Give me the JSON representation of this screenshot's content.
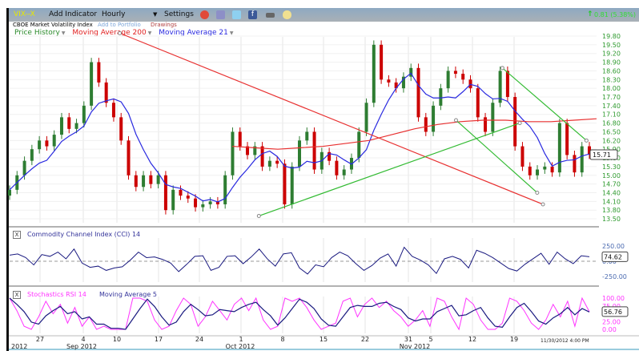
{
  "toolbar": {
    "symbol": "VIX--X",
    "add_indicator": "Add Indicator",
    "interval": "Hourly",
    "settings": "Settings",
    "change": "0.81 (5.38%)",
    "icons": [
      "alarm-clock-icon",
      "portfolio-icon",
      "twitter-icon",
      "facebook-icon",
      "camera-icon",
      "note-icon"
    ]
  },
  "subheader": {
    "name": "CBOE Market Volatility Index",
    "add_to_portfolio": "Add to Portfolio",
    "drawings": "Drawings"
  },
  "legend": {
    "price_history": "Price History",
    "ma200": "Moving Average 200",
    "ma21": "Moving Average 21"
  },
  "colors": {
    "up": "#2e7d32",
    "down": "#cc0000",
    "ma200": "#e83030",
    "ma21": "#2a2ae0",
    "trend": "#33bb33",
    "cci": "#1a1a80",
    "stoch": "#ff33ff",
    "axis_text": "#2e9a2e"
  },
  "chart_data": [
    {
      "type": "candlestick",
      "title": "",
      "ylim": [
        13.5,
        19.8
      ],
      "y_ticks": [
        "19.80",
        "19.50",
        "19.20",
        "18.90",
        "18.60",
        "18.30",
        "18.00",
        "17.70",
        "17.40",
        "17.10",
        "16.80",
        "16.50",
        "16.20",
        "15.90",
        "15.60",
        "15.30",
        "15.00",
        "14.70",
        "14.40",
        "14.10",
        "13.80",
        "13.50"
      ],
      "last_value": "15.71",
      "close": [
        14.5,
        15.0,
        15.5,
        15.9,
        16.2,
        16.0,
        16.4,
        17.0,
        16.6,
        16.8,
        17.4,
        18.9,
        18.2,
        17.5,
        17.0,
        16.2,
        15.0,
        14.6,
        15.0,
        14.7,
        15.0,
        13.8,
        14.5,
        14.3,
        14.2,
        13.9,
        14.0,
        14.1,
        14.0,
        15.0,
        16.5,
        16.0,
        15.7,
        16.0,
        15.3,
        15.5,
        15.4,
        14.0,
        15.3,
        16.2,
        16.5,
        15.2,
        15.8,
        15.5,
        15.0,
        15.2,
        15.6,
        16.5,
        17.5,
        19.5,
        18.3,
        18.2,
        18.0,
        18.4,
        18.7,
        17.0,
        16.5,
        17.4,
        18.0,
        18.6,
        18.5,
        18.3,
        18.0,
        17.0,
        16.5,
        17.5,
        18.6,
        17.7,
        16.0,
        15.3,
        15.0,
        15.2,
        15.3,
        15.1,
        16.8,
        15.7,
        15.1,
        16.0,
        15.71
      ],
      "ma200": [
        16.0,
        15.95,
        15.9,
        15.95,
        16.0,
        16.1,
        16.2,
        16.4,
        16.6,
        16.75,
        16.85,
        16.9,
        16.9,
        16.85,
        16.85,
        16.9,
        16.95
      ],
      "trend_lines": [
        {
          "color": "red",
          "from": [
            0.19,
            19.9
          ],
          "to": [
            0.92,
            14.0
          ]
        },
        {
          "color": "green",
          "from": [
            0.43,
            13.6
          ],
          "to": [
            0.88,
            16.8
          ]
        },
        {
          "color": "green",
          "from": [
            0.77,
            16.9
          ],
          "to": [
            0.91,
            14.4
          ]
        },
        {
          "color": "green",
          "from": [
            0.85,
            18.7
          ],
          "to": [
            0.995,
            16.2
          ]
        }
      ]
    },
    {
      "type": "line",
      "title": "Commodity Channel Index (CCI) 14",
      "y_ticks": [
        "250.00",
        "0.00",
        "-250.00"
      ],
      "ylim": [
        -300,
        300
      ],
      "last_value": "74.62",
      "values": [
        100,
        120,
        60,
        -60,
        110,
        80,
        150,
        40,
        200,
        -30,
        -100,
        -80,
        -150,
        -110,
        -90,
        20,
        150,
        60,
        70,
        30,
        -30,
        -170,
        -50,
        80,
        90,
        -150,
        -100,
        80,
        90,
        -40,
        70,
        200,
        40,
        -80,
        120,
        140,
        -110,
        -210,
        -60,
        -90,
        60,
        150,
        90,
        -40,
        -150,
        -70,
        50,
        120,
        -80,
        230,
        80,
        20,
        -60,
        -200,
        40,
        80,
        30,
        -110,
        180,
        130,
        60,
        -30,
        -120,
        -160,
        -50,
        40,
        130,
        -50,
        150,
        40,
        -40,
        90,
        74.62
      ]
    },
    {
      "type": "line",
      "title": "Stochastics RSI 14",
      "ma_label": "Moving Average 5",
      "y_ticks": [
        "100.00",
        "75.00",
        "25.00",
        "0.00"
      ],
      "ylim": [
        0,
        100
      ],
      "last_value": "56.76",
      "values": [
        100,
        60,
        10,
        0,
        40,
        90,
        50,
        80,
        20,
        70,
        10,
        40,
        0,
        10,
        0,
        0,
        0,
        100,
        100,
        90,
        30,
        0,
        10,
        60,
        100,
        80,
        10,
        40,
        90,
        60,
        30,
        80,
        100,
        60,
        100,
        30,
        0,
        10,
        100,
        90,
        100,
        70,
        30,
        0,
        10,
        20,
        90,
        100,
        40,
        80,
        100,
        70,
        90,
        60,
        40,
        10,
        30,
        60,
        10,
        100,
        90,
        40,
        0,
        100,
        80,
        30,
        0,
        0,
        20,
        100,
        90,
        60,
        20,
        0,
        30,
        80,
        40,
        90,
        10,
        100,
        56.76
      ]
    }
  ],
  "x_axis": {
    "ticks": [
      "27",
      "4",
      "10",
      "17",
      "24",
      "1",
      "8",
      "15",
      "22",
      "31",
      "5",
      "12",
      "19"
    ],
    "months": [
      "2012",
      "Sep 2012",
      "Oct 2012",
      "Nov 2012"
    ],
    "timestamp": "11/30/2012 4:00 PM"
  }
}
